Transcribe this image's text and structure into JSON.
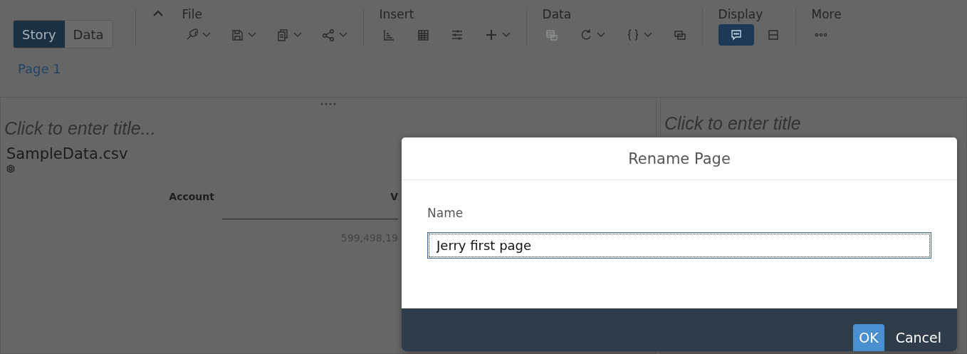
{
  "app_switch": [
    {
      "label": "Story",
      "selected": true
    },
    {
      "label": "Data",
      "selected": false
    }
  ],
  "toolbar": [
    {
      "label": "File",
      "items": [
        {
          "dropdown": true,
          "disabled": false,
          "selected": false
        },
        {
          "dropdown": true,
          "disabled": false,
          "selected": false
        },
        {
          "dropdown": true,
          "disabled": false,
          "selected": false
        },
        {
          "dropdown": true,
          "disabled": false,
          "selected": false
        }
      ]
    },
    {
      "label": "Insert",
      "items": [
        {
          "dropdown": false,
          "disabled": false,
          "selected": false
        },
        {
          "dropdown": false,
          "disabled": false,
          "selected": false
        },
        {
          "dropdown": false,
          "disabled": false,
          "selected": false
        },
        {
          "dropdown": true,
          "disabled": false,
          "selected": false
        }
      ]
    },
    {
      "label": "Data",
      "items": [
        {
          "dropdown": false,
          "disabled": true,
          "selected": false
        },
        {
          "dropdown": true,
          "disabled": false,
          "selected": false
        },
        {
          "dropdown": true,
          "disabled": false,
          "selected": false
        },
        {
          "dropdown": false,
          "disabled": false,
          "selected": false
        }
      ]
    },
    {
      "label": "Display",
      "items": [
        {
          "dropdown": false,
          "disabled": false,
          "selected": true
        },
        {
          "dropdown": false,
          "disabled": false,
          "selected": false
        }
      ]
    },
    {
      "label": "More",
      "items": [
        {
          "dropdown": false,
          "disabled": false,
          "selected": false
        }
      ]
    }
  ],
  "page_tabs": [
    {
      "label": "Page 1",
      "selected": true
    }
  ],
  "left_panel": {
    "title_placeholder": "Click to enter title...",
    "source": "SampleData.csv",
    "table": {
      "columns": [
        "Account",
        "V"
      ],
      "rows": [
        {
          "column_2": "599,498,19"
        }
      ]
    }
  },
  "right_panel": {
    "title_placeholder": "Click to enter title"
  },
  "dialog": {
    "title": "Rename Page",
    "field": {
      "label": "Name",
      "value": "Jerry first page",
      "focused": true
    },
    "buttons": [
      {
        "label": "OK",
        "kind": "primary"
      },
      {
        "label": "Cancel",
        "kind": "secondary"
      }
    ]
  }
}
